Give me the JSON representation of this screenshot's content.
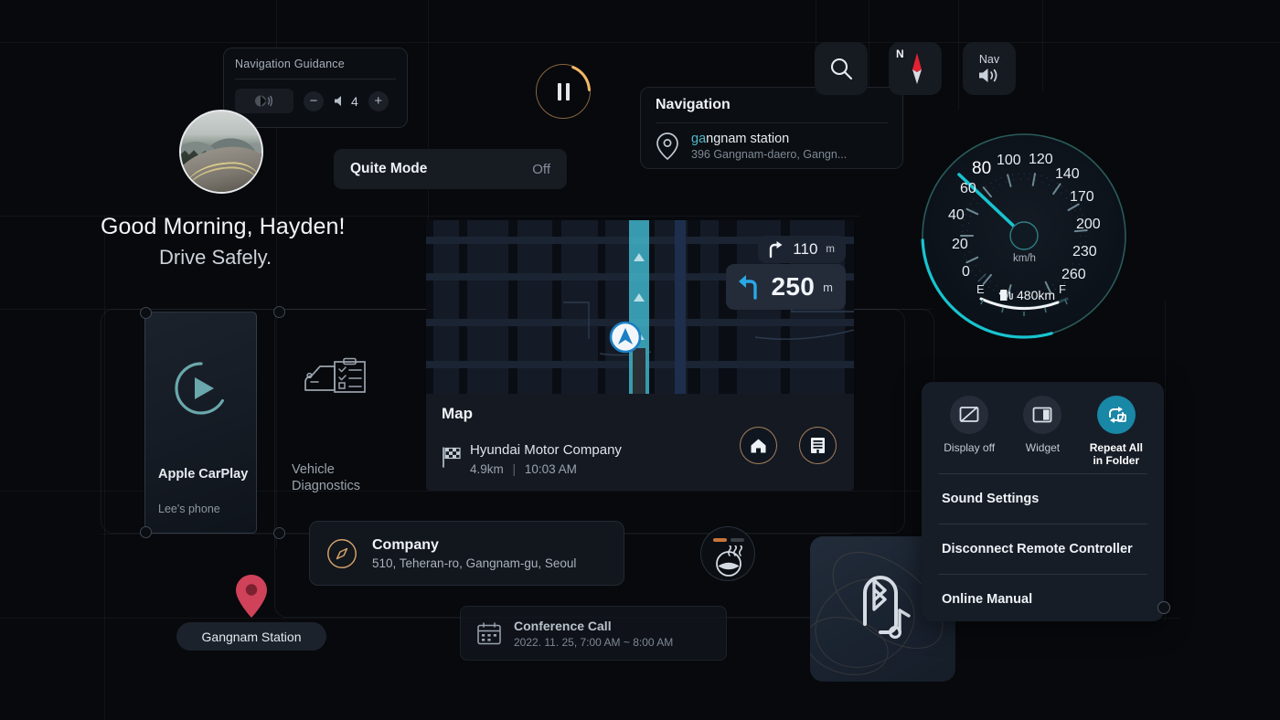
{
  "greeting": {
    "line1": "Good Morning, Hayden!",
    "line2": "Drive Safely."
  },
  "nav_guidance": {
    "title": "Navigation Guidance",
    "voice_icon": "voice-guidance-icon",
    "minus_label": "−",
    "plus_label": "+",
    "volume_value": "4",
    "speaker_icon": "speaker-icon"
  },
  "media": {
    "pause_icon": "pause-icon",
    "progress_percent": 18
  },
  "quite_mode": {
    "label": "Quite Mode",
    "value": "Off"
  },
  "apps": [
    {
      "title": "Apple CarPlay",
      "subtitle": "Lee's phone",
      "icon": "carplay-play-icon",
      "selected": true
    },
    {
      "title": "Vehicle Diagnostics",
      "subtitle": "",
      "icon": "vehicle-diagnostics-icon",
      "selected": false
    }
  ],
  "navigation_card": {
    "header": "Navigation",
    "pin_icon": "map-pin-icon",
    "result_highlight": "ga",
    "result_rest": "ngnam station",
    "result_address": "396 Gangnam-daero, Gangn..."
  },
  "toolbar": {
    "search_icon": "search-icon",
    "compass_icon": "compass-icon",
    "compass_north_label": "N",
    "nav_sound_label": "Nav",
    "nav_sound_icon": "volume-icon"
  },
  "speedometer": {
    "unit": "km/h",
    "ticks": [
      "0",
      "20",
      "40",
      "60",
      "80",
      "100",
      "120",
      "140",
      "170",
      "200",
      "230",
      "260"
    ],
    "current_speed": 80,
    "fuel_empty_label": "E",
    "fuel_full_label": "F",
    "fuel_range": "480km",
    "fuel_icon": "fuel-pump-icon",
    "fuel_level_percent": 80,
    "accent_color": "#17c4cf"
  },
  "map": {
    "title": "Map",
    "destination": "Hyundai Motor Company",
    "distance": "4.9km",
    "separator": "|",
    "eta": "10:03 AM",
    "flag_icon": "checkered-flag-icon",
    "home_icon": "home-icon",
    "office_icon": "office-icon",
    "next_turn": {
      "icon": "turn-right-icon",
      "distance": "110",
      "unit": "m"
    },
    "main_turn": {
      "icon": "turn-left-icon",
      "distance": "250",
      "unit": "m"
    },
    "vehicle_marker": "navigation-arrow-icon"
  },
  "company_card": {
    "icon": "compass-outline-icon",
    "title": "Company",
    "address": "510, Teheran-ro, Gangnam-gu, Seoul"
  },
  "conference_card": {
    "icon": "calendar-icon",
    "title": "Conference Call",
    "schedule": "2022. 11. 25, 7:00 AM ~ 8:00 AM"
  },
  "station_pin": {
    "icon": "location-pin-icon",
    "label": "Gangnam Station",
    "color": "#cf4259"
  },
  "heated_wheel": {
    "icon": "heated-steering-wheel-icon",
    "level": 1,
    "levels": 2,
    "active_color": "#c9743a"
  },
  "bluetooth_panel": {
    "icon": "bluetooth-audio-icon"
  },
  "context_menu": {
    "icon_items": [
      {
        "label": "Display off",
        "icon": "display-off-icon",
        "active": false
      },
      {
        "label": "Widget",
        "icon": "widget-icon",
        "active": false
      },
      {
        "label": "Repeat All\nin Folder",
        "label_line1": "Repeat All",
        "label_line2": "in Folder",
        "icon": "repeat-all-icon",
        "active": true
      }
    ],
    "rows": [
      {
        "label": "Sound Settings"
      },
      {
        "label": "Disconnect Remote Controller"
      },
      {
        "label": "Online Manual"
      }
    ],
    "active_color": "#1987a6"
  }
}
